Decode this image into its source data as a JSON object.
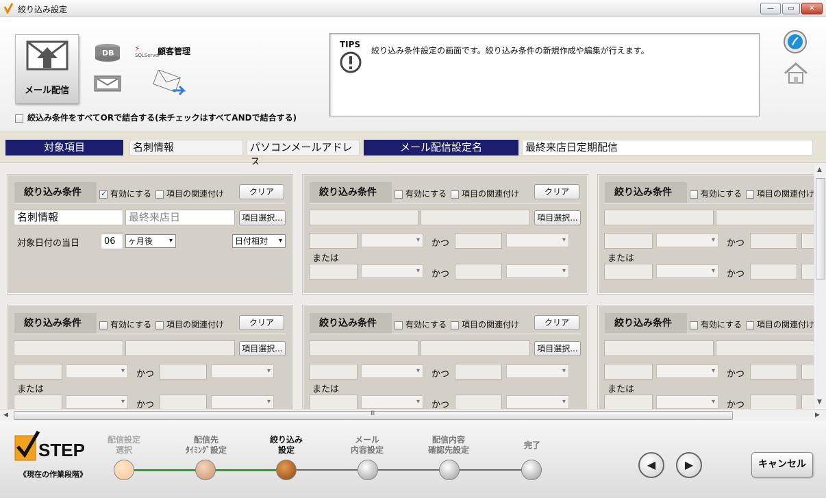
{
  "window": {
    "title": "絞り込み設定",
    "min": "—",
    "max": "▭",
    "close": "✕"
  },
  "header": {
    "mail_button": "メール配信",
    "db_label": "DB",
    "sql_label": "SQLServer",
    "customer_label": "顧客管理",
    "or_checkbox": "絞込み条件をすべてORで結合する(未チェックはすべてANDで結合する)"
  },
  "tips": {
    "head": "TIPS",
    "text": "絞り込み条件設定の画面です。絞り込み条件の新規作成や編集が行えます。"
  },
  "info": {
    "target_label": "対象項目",
    "target_value1": "名刺情報",
    "target_value2": "パソコンメールアドレス",
    "setting_label": "メール配信設定名",
    "setting_value": "最終来店日定期配信"
  },
  "panel": {
    "title": "絞り込み条件",
    "enable": "有効にする",
    "link": "項目の関連付け",
    "clear": "クリア",
    "select": "項目選択...",
    "and": "かつ",
    "or": "または"
  },
  "panel1": {
    "field1": "名刺情報",
    "field2": "最終来店日",
    "cond_label": "対象日付の当日",
    "num": "06",
    "unit": "ヶ月後",
    "mode": "日付相対"
  },
  "footer": {
    "step_logo": "STEP",
    "step_caption": "《現在の作業段階》",
    "steps": [
      {
        "l1": "配信設定",
        "l2": "選択"
      },
      {
        "l1": "配信先",
        "l2": "ﾀｲﾐﾝｸﾞ設定"
      },
      {
        "l1": "絞り込み",
        "l2": "設定"
      },
      {
        "l1": "メール",
        "l2": "内容設定"
      },
      {
        "l1": "配信内容",
        "l2": "確認先設定"
      },
      {
        "l1": "完了",
        "l2": ""
      }
    ],
    "prev": "◀",
    "next": "▶",
    "cancel": "キャンセル"
  },
  "colors": {
    "navy": "#1d1d6e",
    "done": "#f2c79a",
    "current": "#b8641f",
    "progress": "#22a51e"
  },
  "scroll": {
    "hgrip": "Ⅲ",
    "up": "▲",
    "down": "▼",
    "left": "◀",
    "right": "▶"
  }
}
